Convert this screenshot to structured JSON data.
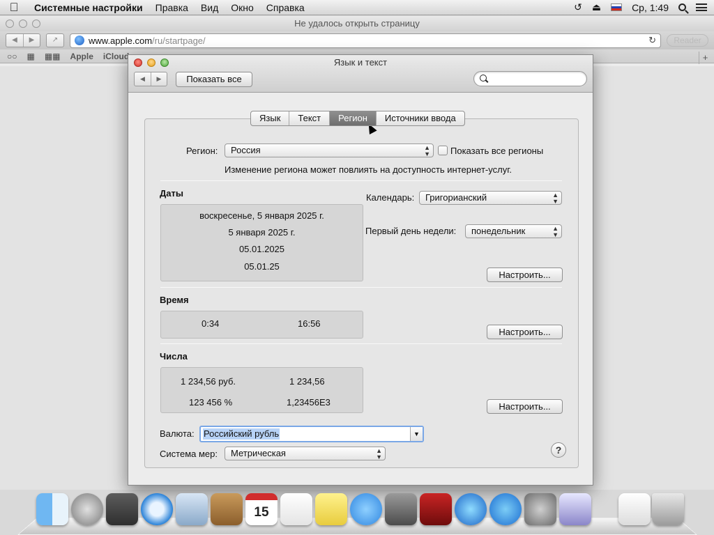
{
  "menubar": {
    "apple_icon": "apple-logo-icon",
    "app_name": "Системные настройки",
    "items": [
      "Правка",
      "Вид",
      "Окно",
      "Справка"
    ],
    "clock": "Ср, 1:49"
  },
  "safari": {
    "title": "Не удалось открыть страницу",
    "url_host": "www.apple.com",
    "url_path": "/ru/startpage/",
    "reader_label": "Reader",
    "bookmarks": [
      "Apple",
      "iCloud"
    ],
    "new_tab_label": "+"
  },
  "prefs": {
    "title": "Язык и текст",
    "show_all_label": "Показать все",
    "nav_back": "◀",
    "nav_forward": "▶",
    "tabs": [
      "Язык",
      "Текст",
      "Регион",
      "Источники ввода"
    ],
    "active_tab": "Регион",
    "region": {
      "label": "Регион:",
      "value": "Россия",
      "show_all_label": "Показать все регионы",
      "show_all_checked": false,
      "note": "Изменение региона может повлиять на доступность интернет-услуг."
    },
    "dates": {
      "header": "Даты",
      "samples": [
        "воскресенье, 5 января 2025 г.",
        "5 января 2025 г.",
        "05.01.2025",
        "05.01.25"
      ],
      "calendar_label": "Календарь:",
      "calendar_value": "Григорианский",
      "first_day_label": "Первый день недели:",
      "first_day_value": "понедельник",
      "customize_label": "Настроить..."
    },
    "time": {
      "header": "Время",
      "short": "0:34",
      "long": "16:56",
      "customize_label": "Настроить..."
    },
    "numbers": {
      "header": "Числа",
      "currency_sample": "1 234,56 руб.",
      "decimal_sample": "1 234,56",
      "percent_sample": "123 456 %",
      "scientific_sample": "1,23456E3",
      "customize_label": "Настроить..."
    },
    "currency": {
      "label": "Валюта:",
      "value": "Российский рубль"
    },
    "measure": {
      "label": "Система мер:",
      "value": "Метрическая"
    },
    "help_label": "?"
  },
  "dock": {
    "calendar_day": "15",
    "apps": [
      "finder",
      "launchpad",
      "mission-control",
      "safari",
      "mail",
      "contacts",
      "calendar",
      "reminders",
      "notes",
      "messages",
      "facetime",
      "photo-booth",
      "itunes",
      "app-store",
      "system-preferences",
      "migration-assistant",
      "preview-document",
      "trash"
    ]
  },
  "colors": {
    "accent_selection": "#b7d2f6",
    "active_tab": "#7a7a7a",
    "close": "#d3362d",
    "minimize": "#e6a21d",
    "zoom": "#4ea73b"
  }
}
